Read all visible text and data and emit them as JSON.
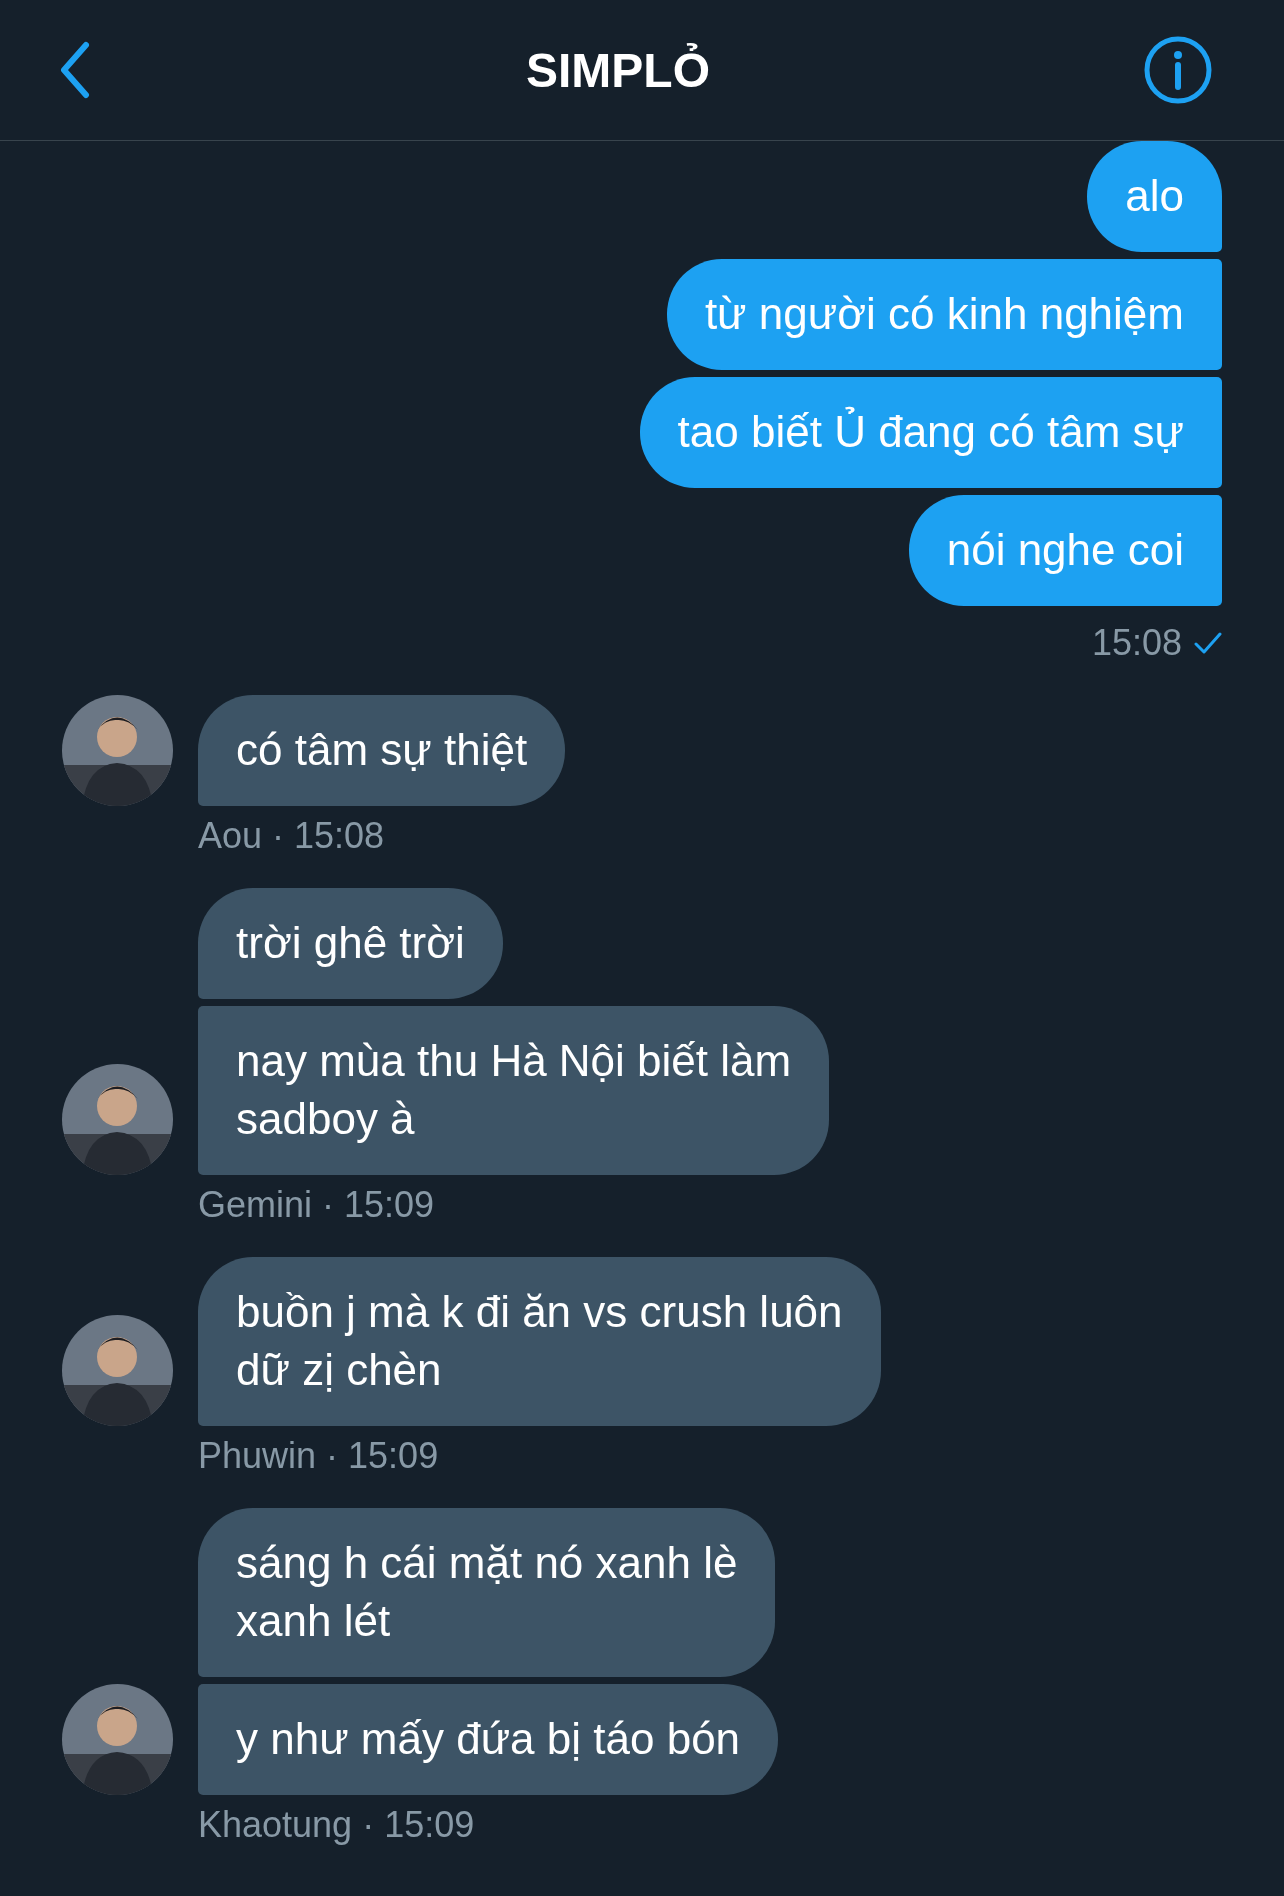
{
  "header": {
    "title": "SIMPLỎ"
  },
  "sent": {
    "messages": [
      "alo",
      "từ người có kinh nghiệm",
      "tao biết Ủ đang có tâm sự",
      "nói nghe coi"
    ],
    "time": "15:08",
    "read": true
  },
  "groups": [
    {
      "meta": "Aou · 15:08",
      "messages": [
        "có tâm sự thiệt"
      ]
    },
    {
      "meta": "Gemini · 15:09",
      "messages": [
        "trời ghê trời",
        "nay mùa thu Hà Nội biết làm\nsadboy à"
      ]
    },
    {
      "meta": "Phuwin · 15:09",
      "messages": [
        "buồn j mà k đi ăn vs crush luôn\ndữ zị chèn"
      ]
    },
    {
      "meta": "Khaotung · 15:09",
      "messages": [
        "sáng h cái mặt nó xanh lè\nxanh lét",
        "y như mấy đứa bị táo bón"
      ]
    }
  ]
}
